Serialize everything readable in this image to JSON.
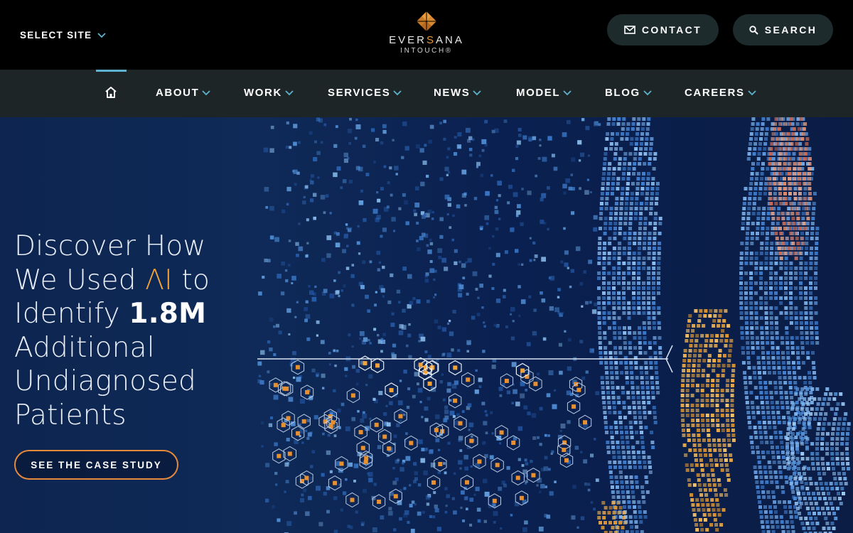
{
  "header": {
    "select_site": "SELECT SITE",
    "logo": {
      "word_left": "EVER",
      "word_accent": "S",
      "word_right": "ANA",
      "sub": "INTOUCH®"
    },
    "contact_label": "CONTACT",
    "search_label": "SEARCH"
  },
  "nav": {
    "items": [
      {
        "label": "ABOUT"
      },
      {
        "label": "WORK"
      },
      {
        "label": "SERVICES"
      },
      {
        "label": "NEWS"
      },
      {
        "label": "MODEL"
      },
      {
        "label": "BLOG"
      },
      {
        "label": "CAREERS"
      }
    ]
  },
  "hero": {
    "line1": "Discover How",
    "line2_pre": "We Used ",
    "line2_ai": "ΛI",
    "line2_post": " to",
    "line3_pre": "Identify ",
    "line3_big": "1.8M",
    "line4": "Additional",
    "line5": "Undiagnosed",
    "line6": "Patients",
    "cta_label": "SEE THE CASE STUDY"
  },
  "colors": {
    "accent_orange": "#e89a3c",
    "nav_active": "#5db3d1",
    "chevron": "#5db3d1",
    "hero_bg": "#0d2550"
  },
  "icons": [
    "chevron-down-icon",
    "mail-icon",
    "search-icon",
    "home-icon",
    "eversana-logo-mark"
  ]
}
